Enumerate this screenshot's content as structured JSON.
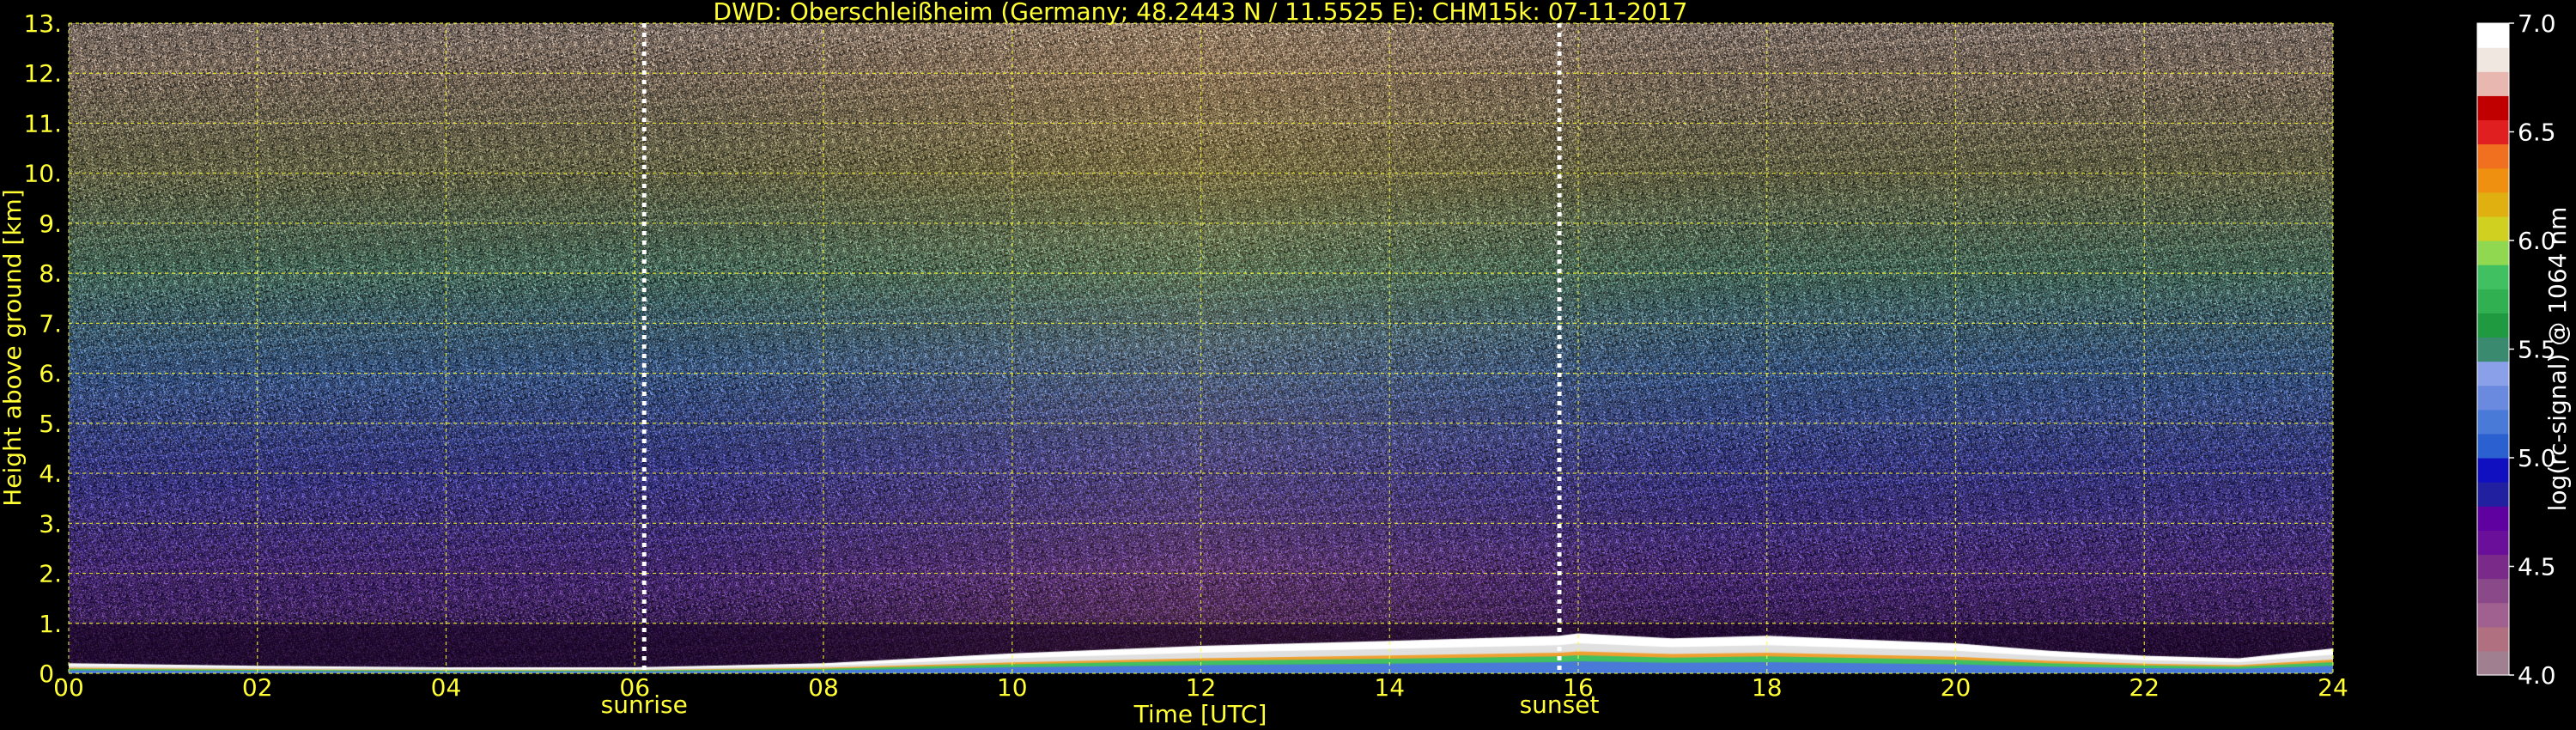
{
  "chart_data": {
    "type": "heatmap",
    "title": "DWD: Oberschleißheim (Germany; 48.2443 N / 11.5525 E):    CHM15k: 07-11-2017",
    "xlabel": "Time [UTC]",
    "ylabel": "Height above ground [km]",
    "xlim": [
      0,
      24
    ],
    "ylim": [
      0,
      13
    ],
    "x_ticks": [
      "00",
      "02",
      "04",
      "06",
      "08",
      "10",
      "12",
      "14",
      "16",
      "18",
      "20",
      "22",
      "24"
    ],
    "y_ticks": [
      "0.",
      "1.",
      "2.",
      "3.",
      "4.",
      "5.",
      "6.",
      "7.",
      "8.",
      "9.",
      "10.",
      "11.",
      "12.",
      "13."
    ],
    "grid": true,
    "markers": [
      {
        "label": "sunrise",
        "x": 6.1
      },
      {
        "label": "sunset",
        "x": 15.8
      }
    ],
    "colorbar": {
      "label": "log(rc-signal) @ 1064 nm",
      "range": [
        4.0,
        7.0
      ],
      "ticks": [
        "4.0",
        "4.5",
        "5.0",
        "5.5",
        "6.0",
        "6.5",
        "7.0"
      ],
      "colors": [
        "#a08090",
        "#b07080",
        "#a06090",
        "#8a4a8a",
        "#7a2a88",
        "#6a0f9a",
        "#5f00a0",
        "#2020a0",
        "#1010c0",
        "#2a60d0",
        "#4a7ad8",
        "#6a8ae0",
        "#8aa0e8",
        "#3a8a70",
        "#209a40",
        "#30b050",
        "#40c060",
        "#90d850",
        "#d0d020",
        "#e0b010",
        "#f09010",
        "#f07020",
        "#e02020",
        "#c00000",
        "#e8b8b0",
        "#f0e8e0",
        "#ffffff"
      ]
    },
    "boundary_layer_top_km": [
      {
        "time": 0,
        "height": 0.2
      },
      {
        "time": 2,
        "height": 0.15
      },
      {
        "time": 4,
        "height": 0.12
      },
      {
        "time": 6,
        "height": 0.12
      },
      {
        "time": 8,
        "height": 0.2
      },
      {
        "time": 10,
        "height": 0.4
      },
      {
        "time": 12,
        "height": 0.55
      },
      {
        "time": 14,
        "height": 0.65
      },
      {
        "time": 15.8,
        "height": 0.75
      },
      {
        "time": 16,
        "height": 0.8
      },
      {
        "time": 17,
        "height": 0.7
      },
      {
        "time": 18,
        "height": 0.75
      },
      {
        "time": 20,
        "height": 0.6
      },
      {
        "time": 21,
        "height": 0.45
      },
      {
        "time": 22,
        "height": 0.35
      },
      {
        "time": 23,
        "height": 0.3
      },
      {
        "time": 24,
        "height": 0.5
      }
    ],
    "background_color_by_height_km": [
      {
        "height": 0.5,
        "color": "#3a1c55"
      },
      {
        "height": 2,
        "color": "#4a2a78"
      },
      {
        "height": 4,
        "color": "#3c3a8a"
      },
      {
        "height": 6,
        "color": "#3c5a8a"
      },
      {
        "height": 8,
        "color": "#4a7060"
      },
      {
        "height": 10,
        "color": "#6a6a4a"
      },
      {
        "height": 12,
        "color": "#807060"
      },
      {
        "height": 13,
        "color": "#8a7a70"
      }
    ]
  }
}
